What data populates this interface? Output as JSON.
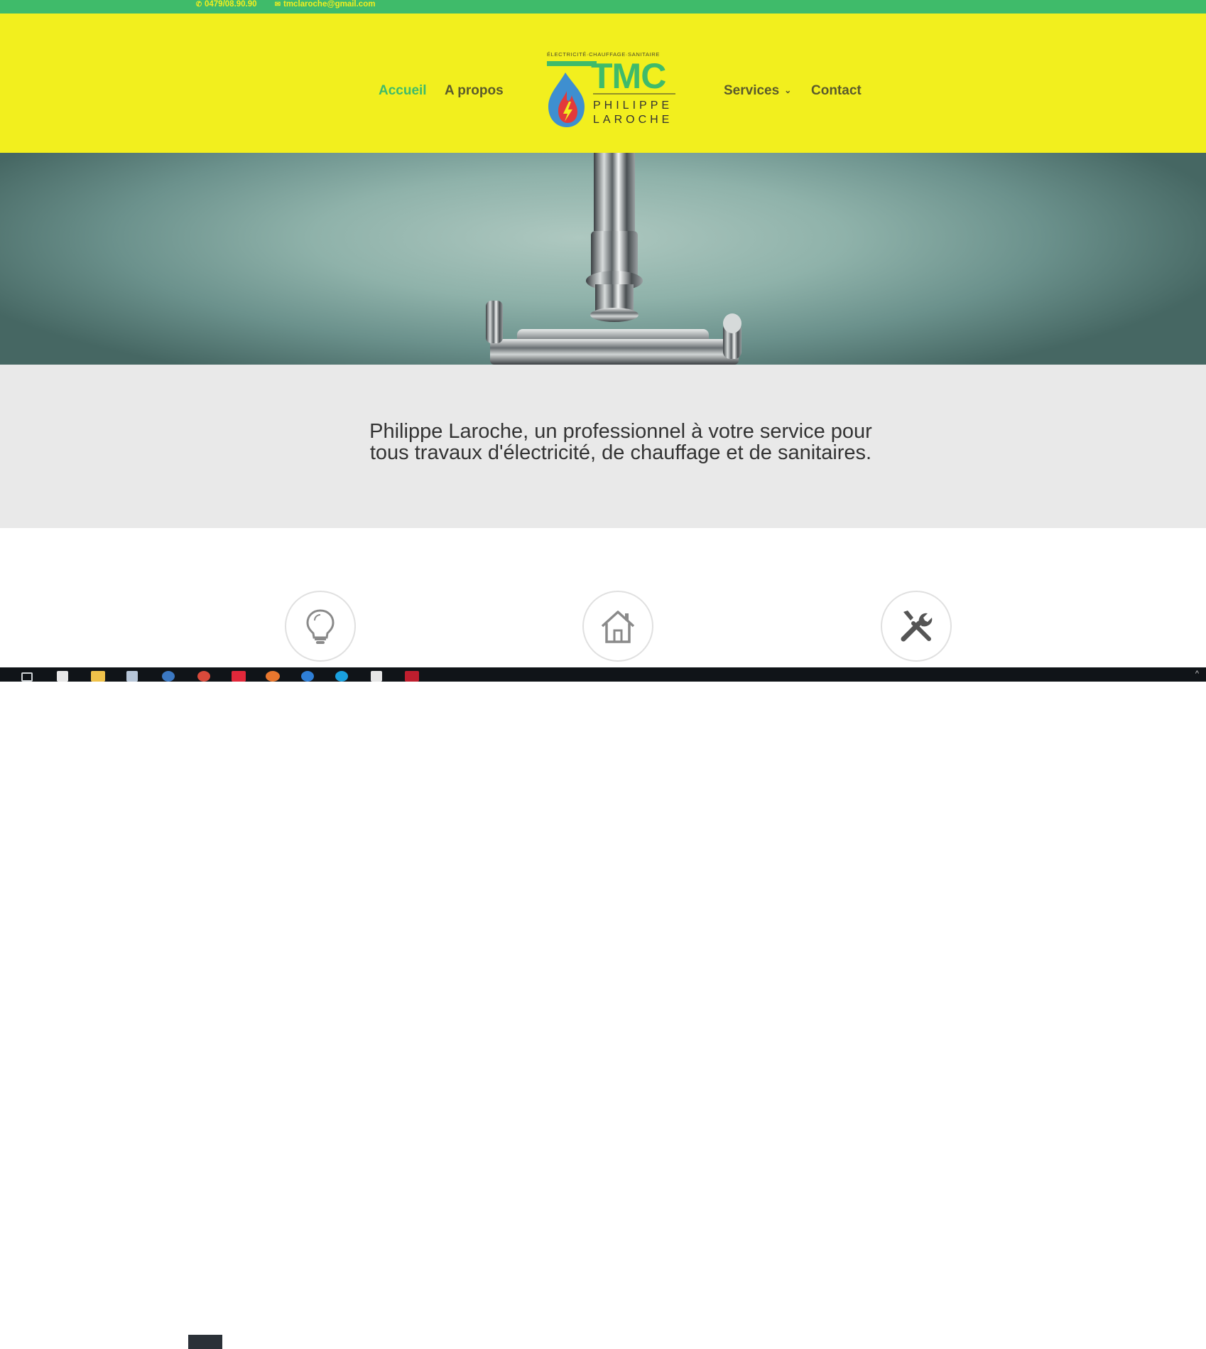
{
  "topbar": {
    "phone": "0479/08.90.90",
    "phone_icon": "phone-icon",
    "email": "tmclaroche@gmail.com",
    "email_icon": "envelope-icon",
    "background": "#3fbb6a",
    "text_color": "#f2ef1e"
  },
  "nav": {
    "home": "Accueil",
    "about": "A propos",
    "services": "Services",
    "contact": "Contact",
    "active_color": "#3fbb6a",
    "link_color": "#5a5a2c"
  },
  "logo": {
    "tagline": "ÉLECTRICITÉ·CHAUFFAGE·SANITAIRE",
    "brand": "TMC",
    "name_first": "PHILIPPE",
    "name_last": "LAROCHE",
    "brand_color": "#3fbb6a"
  },
  "header": {
    "background": "#f2ef1e"
  },
  "hero": {
    "image": "chrome-faucet-photo"
  },
  "intro": {
    "line1": "Philippe Laroche, un professionnel à votre service pour",
    "line2": "tous travaux d'électricité, de chauffage et de sanitaires."
  },
  "services": [
    {
      "icon": "lightbulb-icon"
    },
    {
      "icon": "house-icon"
    },
    {
      "icon": "tools-icon"
    }
  ],
  "taskbar": {
    "icons": [
      "task-view-icon",
      "store-icon",
      "file-explorer-icon",
      "notepad-icon",
      "browser-icon",
      "chrome-icon",
      "vivaldi-icon",
      "firefox-icon",
      "edge-icon",
      "skype-icon",
      "calculator-icon",
      "filezilla-icon"
    ],
    "tray": "^"
  }
}
